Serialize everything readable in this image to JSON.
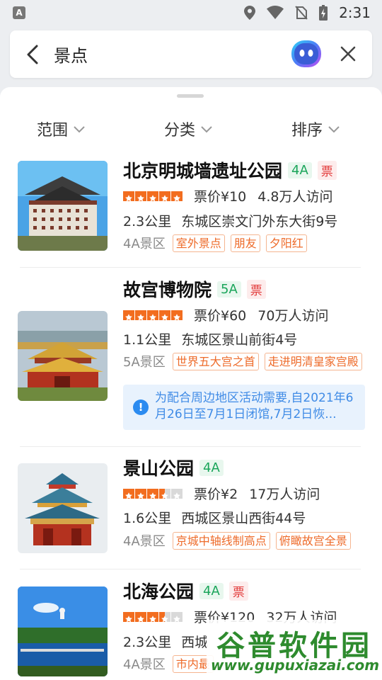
{
  "status_bar": {
    "time": "2:31",
    "notification_icon_letter": "A"
  },
  "search": {
    "query": "景点"
  },
  "filters": [
    {
      "label": "范围"
    },
    {
      "label": "分类"
    },
    {
      "label": "排序"
    }
  ],
  "colors": {
    "accent_green": "#1aa55a",
    "tag_orange": "#ee6b2a",
    "star_orange": "#f26d1f",
    "notice_blue": "#3f8be6"
  },
  "results": [
    {
      "name": "北京明城墙遗址公园",
      "level": "4A",
      "ticket": "票",
      "rating_stars": 5,
      "price": "票价¥10",
      "visitors": "4.8万人访问",
      "distance": "2.3公里",
      "address": "东城区崇文门外东大街9号",
      "grade_label": "4A景区",
      "tags": [
        "室外景点",
        "朋友",
        "夕阳红"
      ]
    },
    {
      "name": "故宫博物院",
      "level": "5A",
      "ticket": "票",
      "rating_stars": 5,
      "price": "票价¥60",
      "visitors": "70万人访问",
      "distance": "1.1公里",
      "address": "东城区景山前街4号",
      "grade_label": "5A景区",
      "tags": [
        "世界五大宫之首",
        "走进明清皇家宫殿"
      ],
      "notice": "为配合周边地区活动需要,自2021年6月26日至7月1日闭馆,7月2日恢..."
    },
    {
      "name": "景山公园",
      "level": "4A",
      "rating_stars": 3.5,
      "price": "票价¥2",
      "visitors": "17万人访问",
      "distance": "1.6公里",
      "address": "西城区景山西街44号",
      "grade_label": "4A景区",
      "tags": [
        "京城中轴线制高点",
        "俯瞰故宫全景"
      ]
    },
    {
      "name": "北海公园",
      "level": "4A",
      "ticket": "票",
      "rating_stars": 3.5,
      "price": "票价¥120",
      "visitors": "32万人访问",
      "distance": "2.3公里",
      "address": "西城",
      "grade_label": "4A景区",
      "tags": [
        "市内最"
      ]
    }
  ],
  "watermark": {
    "line1": "谷普软件园",
    "line2": "www.gupuxiazai.com"
  }
}
